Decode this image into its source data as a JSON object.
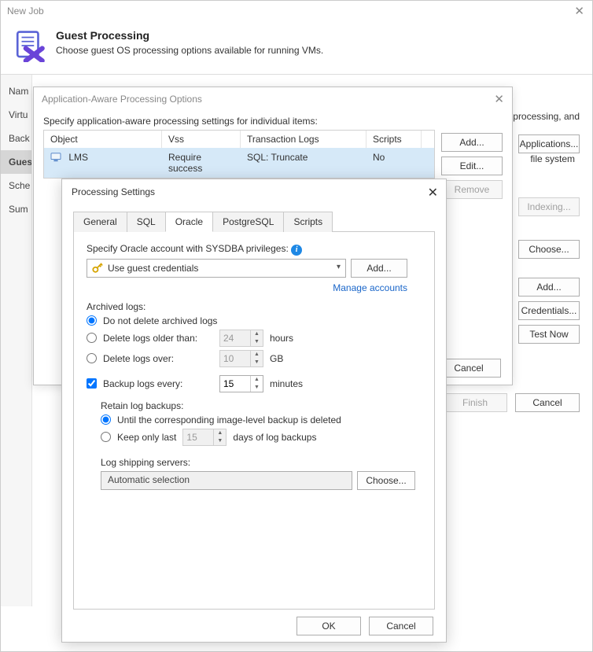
{
  "newjob": {
    "title": "New Job",
    "header_title": "Guest Processing",
    "header_desc": "Choose guest OS processing options available for running VMs.",
    "nav": {
      "items": [
        {
          "label": "Nam"
        },
        {
          "label": "Virtu"
        },
        {
          "label": "Back"
        },
        {
          "label": "Gues"
        },
        {
          "label": "Sche"
        },
        {
          "label": "Sum"
        }
      ],
      "selected_index": 3
    },
    "bg_text_right": "processing, and",
    "fs_label": "file system",
    "right_buttons": {
      "applications": "Applications...",
      "indexing": "Indexing...",
      "choose": "Choose...",
      "add": "Add...",
      "credentials": "Credentials...",
      "test_now": "Test Now"
    },
    "footer": {
      "finish": "Finish",
      "cancel": "Cancel"
    }
  },
  "appaware": {
    "title": "Application-Aware Processing Options",
    "subtitle": "Specify application-aware processing settings for individual items:",
    "columns": {
      "object": "Object",
      "vss": "Vss",
      "tlogs": "Transaction Logs",
      "scripts": "Scripts"
    },
    "rows": [
      {
        "object": "LMS",
        "vss": "Require success",
        "tlogs": "SQL: Truncate",
        "scripts": "No"
      }
    ],
    "buttons": {
      "add": "Add...",
      "edit": "Edit...",
      "remove": "Remove"
    },
    "footer": {
      "cancel": "Cancel"
    }
  },
  "procsettings": {
    "title": "Processing Settings",
    "tabs": [
      "General",
      "SQL",
      "Oracle",
      "PostgreSQL",
      "Scripts"
    ],
    "active_tab_index": 2,
    "oracle": {
      "account_label": "Specify Oracle account with SYSDBA privileges:",
      "credentials_value": "Use guest credentials",
      "add_btn": "Add...",
      "manage_link": "Manage accounts",
      "archived_label": "Archived logs:",
      "opt_do_not_delete": "Do not delete archived logs",
      "opt_older_than": "Delete logs older than:",
      "older_than_value": "24",
      "older_than_unit": "hours",
      "opt_logs_over": "Delete logs over:",
      "logs_over_value": "10",
      "logs_over_unit": "GB",
      "chk_backup_every": "Backup logs every:",
      "backup_every_value": "15",
      "backup_every_unit": "minutes",
      "retain_label": "Retain log backups:",
      "opt_until_deleted": "Until the corresponding image-level backup is deleted",
      "opt_keep_only_last": "Keep only last",
      "keep_only_last_value": "15",
      "keep_only_last_unit": "days of log backups",
      "logship_label": "Log shipping servers:",
      "logship_value": "Automatic selection",
      "choose_btn": "Choose..."
    },
    "footer": {
      "ok": "OK",
      "cancel": "Cancel"
    }
  }
}
